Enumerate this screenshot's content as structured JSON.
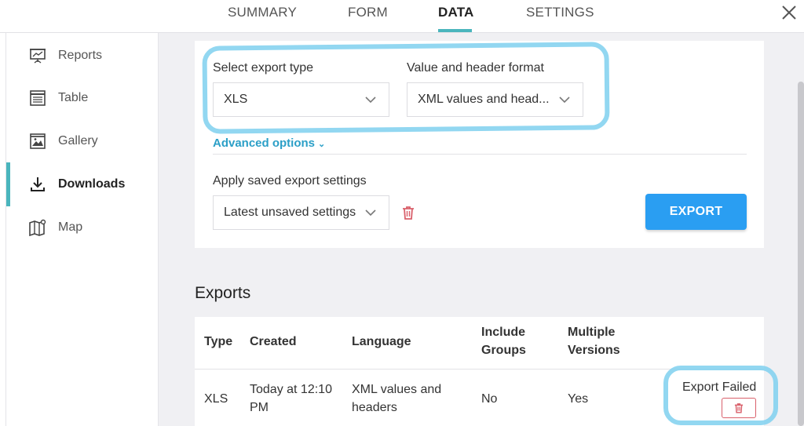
{
  "tabs": [
    {
      "label": "SUMMARY"
    },
    {
      "label": "FORM"
    },
    {
      "label": "DATA"
    },
    {
      "label": "SETTINGS"
    }
  ],
  "sidebar": {
    "items": [
      {
        "label": "Reports",
        "icon": "presentation-icon"
      },
      {
        "label": "Table",
        "icon": "table-icon"
      },
      {
        "label": "Gallery",
        "icon": "image-icon"
      },
      {
        "label": "Downloads",
        "icon": "download-icon"
      },
      {
        "label": "Map",
        "icon": "map-icon"
      }
    ]
  },
  "export_form": {
    "type_label": "Select export type",
    "type_value": "XLS",
    "format_label": "Value and header format",
    "format_value": "XML values and head...",
    "advanced_label": "Advanced options",
    "saved_label": "Apply saved export settings",
    "saved_value": "Latest unsaved settings",
    "export_button": "EXPORT"
  },
  "exports": {
    "title": "Exports",
    "headers": {
      "type": "Type",
      "created": "Created",
      "language": "Language",
      "include_groups_1": "Include",
      "include_groups_2": "Groups",
      "multiple_versions_1": "Multiple",
      "multiple_versions_2": "Versions"
    },
    "rows": [
      {
        "type": "XLS",
        "created_1": "Today at 12:10",
        "created_2": "PM",
        "language_1": "XML values and",
        "language_2": "headers",
        "include_groups": "No",
        "multiple_versions": "Yes",
        "status": "Export Failed"
      }
    ]
  },
  "colors": {
    "accent": "#4ab5bd",
    "primary_button": "#2a9ef2",
    "link": "#2b9fc7",
    "danger": "#d9606b",
    "highlight": "#7fd0ee"
  }
}
